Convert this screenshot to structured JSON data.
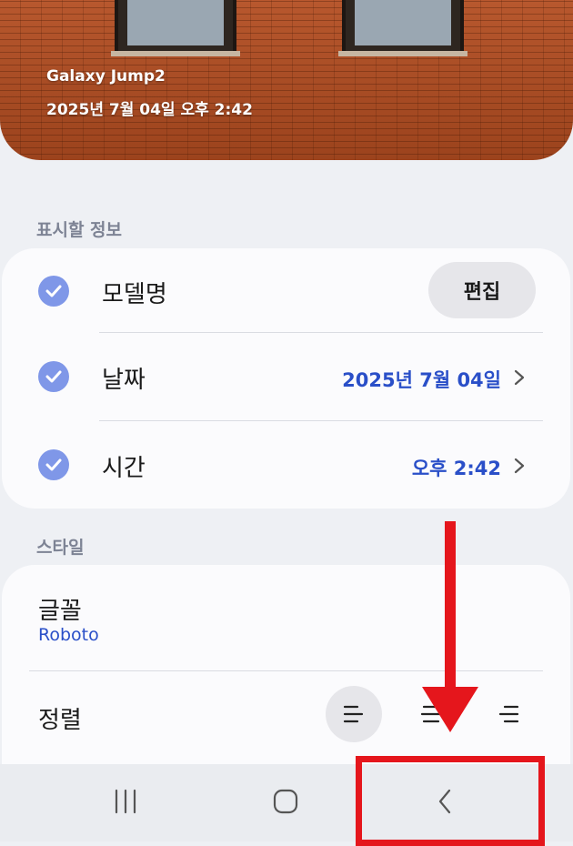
{
  "hero": {
    "device_name": "Galaxy Jump2",
    "datetime": "2025년 7월 04일 오후 2:42"
  },
  "display_info": {
    "section_label": "표시할 정보",
    "rows": [
      {
        "label": "모델명",
        "checked": true,
        "action_label": "편집"
      },
      {
        "label": "날짜",
        "checked": true,
        "value": "2025년 7월 04일"
      },
      {
        "label": "시간",
        "checked": true,
        "value": "오후 2:42"
      }
    ]
  },
  "style": {
    "section_label": "스타일",
    "font_label": "글꼴",
    "font_value": "Roboto",
    "align_label": "정렬",
    "align_options": [
      "align-left-icon",
      "align-center-icon",
      "align-right-icon"
    ],
    "align_selected": "align-left-icon"
  },
  "navbar": {
    "buttons": [
      "recent-apps-icon",
      "home-icon",
      "back-icon"
    ]
  },
  "colors": {
    "accent": "#2a4fc8",
    "check": "#7f97e8",
    "annotation": "#e5161c"
  }
}
